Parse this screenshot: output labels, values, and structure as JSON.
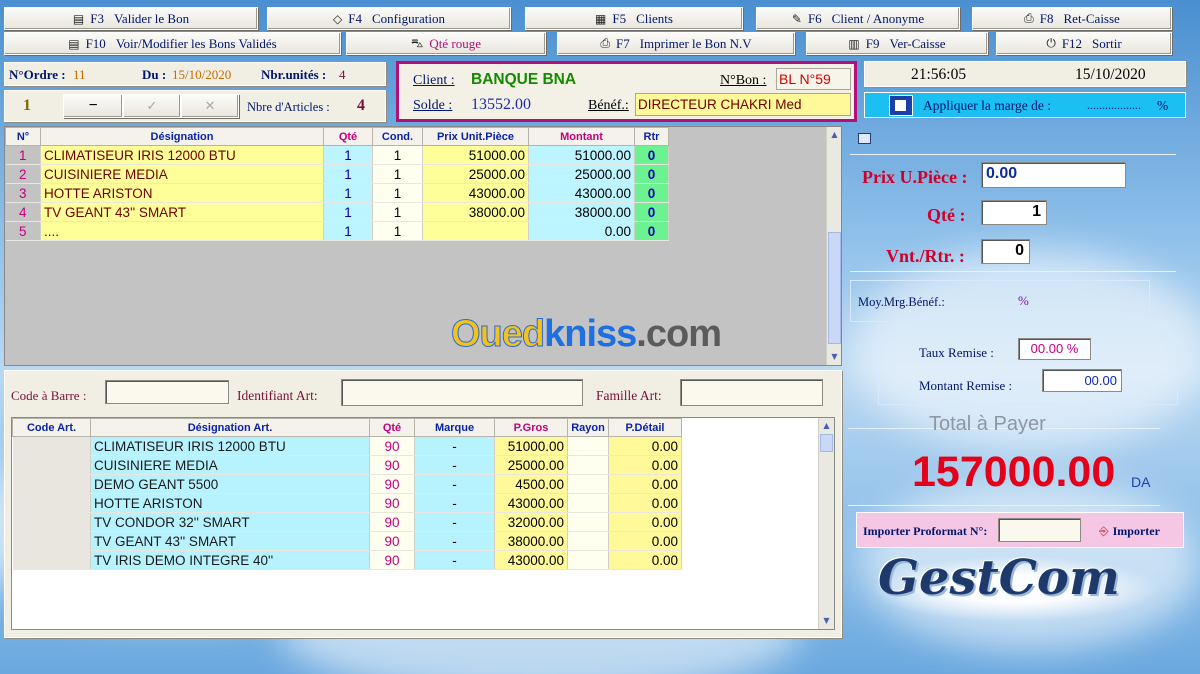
{
  "toolbar_row1": [
    {
      "key": "F3",
      "label": "Valider le Bon",
      "icon": "receipt-icon",
      "glyph": "▤"
    },
    {
      "key": "F4",
      "label": "Configuration",
      "icon": "config-icon",
      "glyph": "◇"
    },
    {
      "key": "F5",
      "label": "Clients",
      "icon": "calculator-icon",
      "glyph": "▦"
    },
    {
      "key": "F6",
      "label": "Client / Anonyme",
      "icon": "pen-icon",
      "glyph": "✎"
    },
    {
      "key": "F8",
      "label": "Ret-Caisse",
      "icon": "printer-icon",
      "glyph": "⎙"
    }
  ],
  "toolbar_row2": [
    {
      "key": "F10",
      "label": "Voir/Modifier les Bons Validés",
      "icon": "document-icon",
      "glyph": "▤"
    },
    {
      "key": "",
      "label": "Qté rouge",
      "icon": "car-icon",
      "glyph": "⛍"
    },
    {
      "key": "F7",
      "label": "Imprimer le Bon N.V",
      "icon": "printer-icon",
      "glyph": "⎙"
    },
    {
      "key": "F9",
      "label": "Ver-Caisse",
      "icon": "cash-icon",
      "glyph": "▥"
    },
    {
      "key": "F12",
      "label": "Sortir",
      "icon": "power-icon",
      "glyph": "⏻"
    }
  ],
  "info": {
    "ordre_label": "N°Ordre :",
    "ordre_value": "11",
    "du_label": "Du :",
    "du_value": "15/10/2020",
    "nbr_unites_label": "Nbr.unités :",
    "nbr_unites_value": "4",
    "counter_value": "1",
    "minus": "−",
    "check": "✓",
    "cross": "✕",
    "nbre_articles_label": "Nbre d'Articles :",
    "nbre_articles_value": "4"
  },
  "client": {
    "client_label": "Client :",
    "client_value": "BANQUE BNA",
    "nbon_label": "N°Bon :",
    "nbon_value": "BL N°59",
    "solde_label": "Solde :",
    "solde_value": "13552.00",
    "benef_label": "Bénéf.:",
    "benef_value": "DIRECTEUR CHAKRI Med"
  },
  "clock": {
    "time": "21:56:05",
    "date": "15/10/2020"
  },
  "marge": {
    "label": "Appliquer la marge de :",
    "dots": "..................",
    "unit": "%"
  },
  "bon_table": {
    "headers": [
      "N°",
      "Désignation",
      "Qté",
      "Cond.",
      "Prix Unit.Pièce",
      "Montant",
      "Rtr"
    ],
    "rows": [
      [
        "1",
        "CLIMATISEUR IRIS 12000 BTU",
        "1",
        "1",
        "51000.00",
        "51000.00",
        "0"
      ],
      [
        "2",
        "CUISINIERE MEDIA",
        "1",
        "1",
        "25000.00",
        "25000.00",
        "0"
      ],
      [
        "3",
        "HOTTE ARISTON",
        "1",
        "1",
        "43000.00",
        "43000.00",
        "0"
      ],
      [
        "4",
        "TV GEANT 43'' SMART",
        "1",
        "1",
        "38000.00",
        "38000.00",
        "0"
      ],
      [
        "5",
        "....",
        "1",
        "1",
        "",
        "0.00",
        "0"
      ]
    ]
  },
  "watermark": {
    "blue": "Oued",
    "gray": "kniss",
    "tail": ".com"
  },
  "search": {
    "code_label": "Code à Barre :",
    "ident_label": "Identifiant Art:",
    "famille_label": "Famille Art:"
  },
  "article_table": {
    "headers": [
      "Code Art.",
      "Désignation Art.",
      "Qté",
      "Marque",
      "P.Gros",
      "Rayon",
      "P.Détail"
    ],
    "rows": [
      [
        "",
        "CLIMATISEUR IRIS 12000 BTU",
        "90",
        "-",
        "51000.00",
        "",
        "0.00"
      ],
      [
        "",
        "CUISINIERE MEDIA",
        "90",
        "-",
        "25000.00",
        "",
        "0.00"
      ],
      [
        "",
        "DEMO GEANT 5500",
        "90",
        "-",
        "4500.00",
        "",
        "0.00"
      ],
      [
        "",
        "HOTTE ARISTON",
        "90",
        "-",
        "43000.00",
        "",
        "0.00"
      ],
      [
        "",
        "TV CONDOR 32'' SMART",
        "90",
        "-",
        "32000.00",
        "",
        "0.00"
      ],
      [
        "",
        "TV GEANT 43'' SMART",
        "90",
        "-",
        "38000.00",
        "",
        "0.00"
      ],
      [
        "",
        "TV IRIS DEMO INTEGRE 40''",
        "90",
        "-",
        "43000.00",
        "",
        "0.00"
      ]
    ]
  },
  "right": {
    "prix_label": "Prix U.Pièce :",
    "prix_value": "0.00",
    "qte_label": "Qté :",
    "qte_value": "1",
    "vnt_label": "Vnt./Rtr. :",
    "vnt_value": "0",
    "moy_label": "Moy.Mrg.Bénéf.:",
    "moy_unit": "%",
    "taux_label": "Taux Remise :",
    "taux_value": "00.00 %",
    "montant_label": "Montant Remise :",
    "montant_value": "00.00",
    "total_label": "Total à Payer",
    "total_value": "157000.00",
    "currency": "DA",
    "import_label": "Importer Proformat N°:",
    "import_button": "Importer",
    "logo_text": "GestCom"
  },
  "colors": {
    "toolbar_text": "#00156e",
    "total_red": "#e2001a",
    "pink_panel": "#f6c7e4"
  }
}
